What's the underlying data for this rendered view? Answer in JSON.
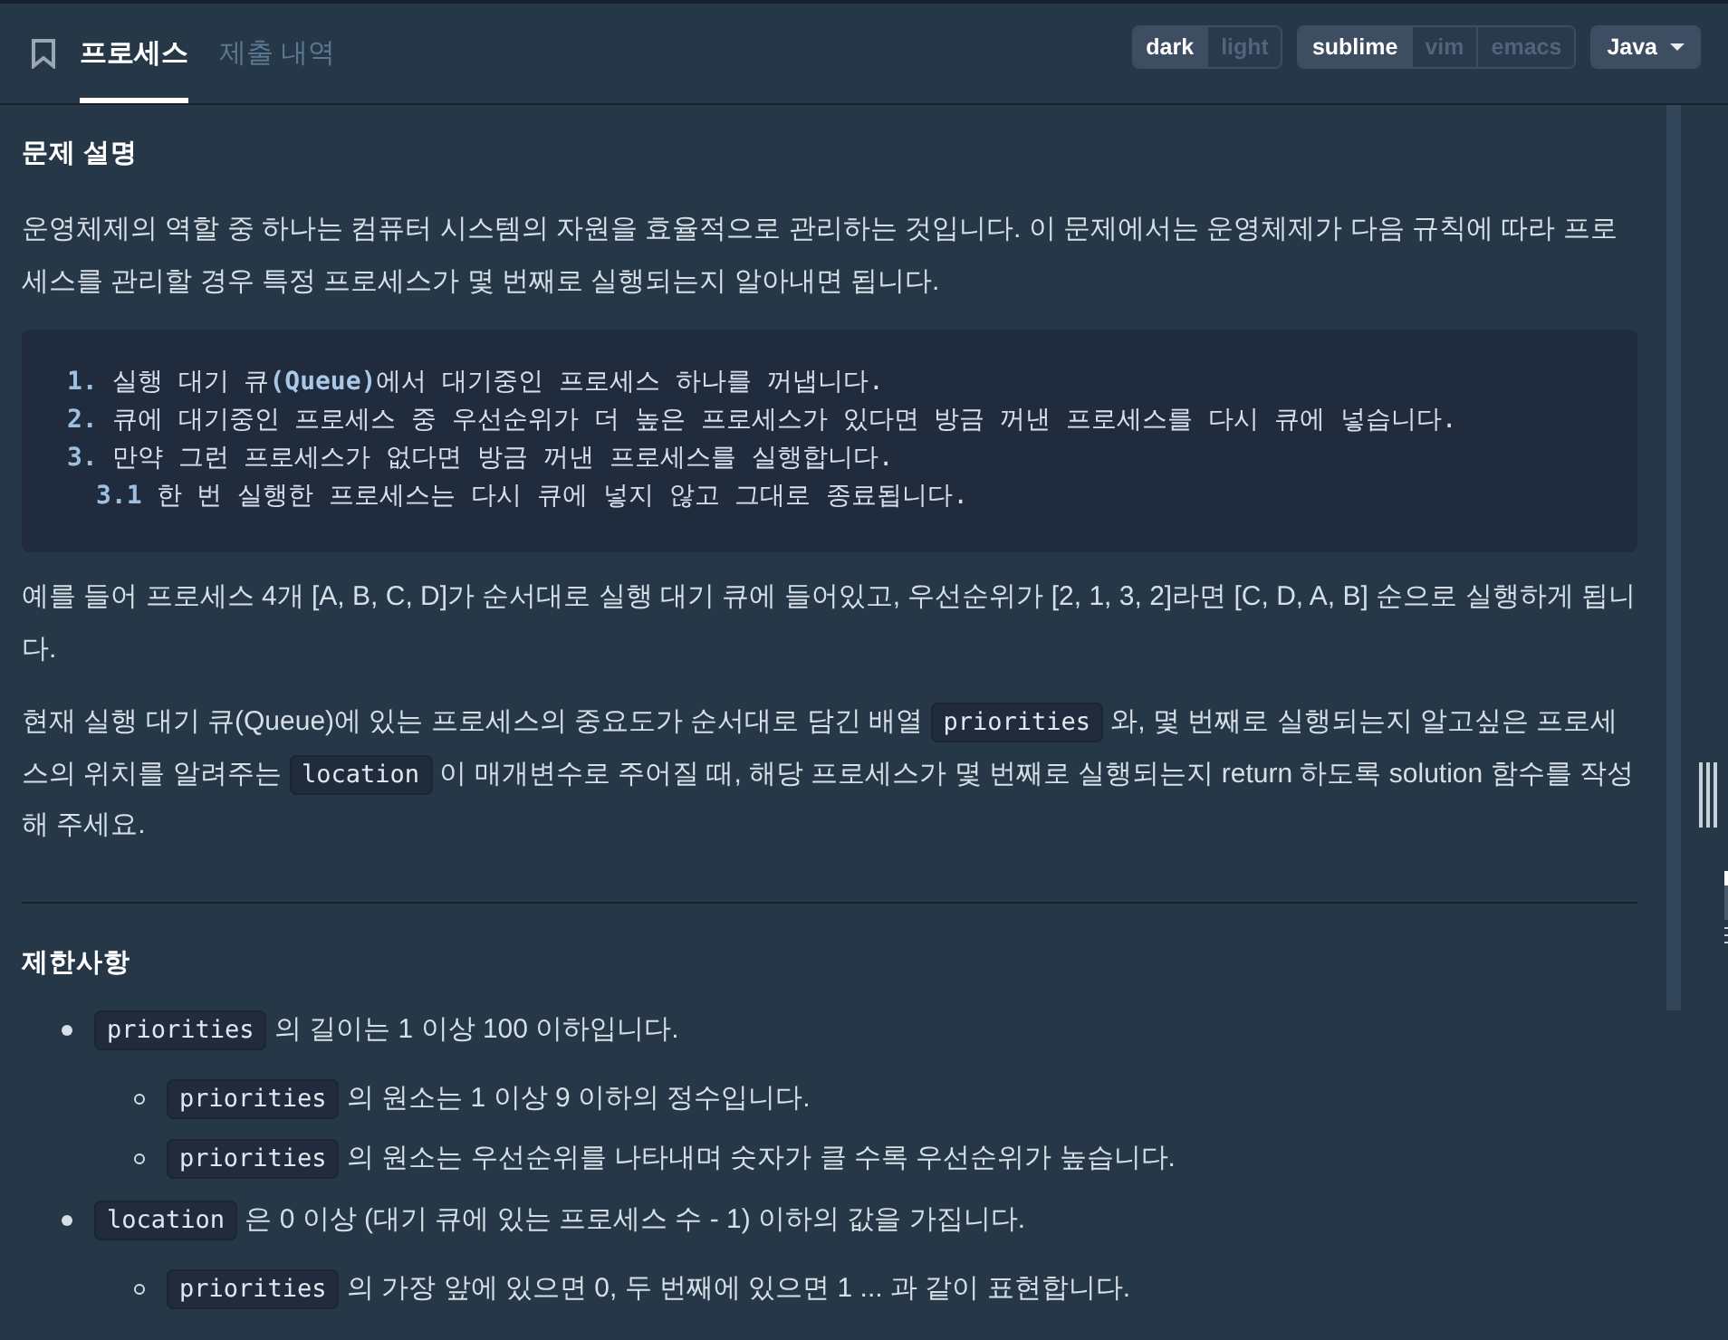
{
  "header": {
    "tabs": [
      {
        "label": "프로세스",
        "selected": true
      },
      {
        "label": "제출 내역",
        "selected": false
      }
    ],
    "theme_toggle": [
      {
        "label": "dark",
        "selected": true
      },
      {
        "label": "light",
        "selected": false
      }
    ],
    "keymap_toggle": [
      {
        "label": "sublime",
        "selected": true
      },
      {
        "label": "vim",
        "selected": false
      },
      {
        "label": "emacs",
        "selected": false
      }
    ],
    "language_dropdown": {
      "value": "Java"
    }
  },
  "sections": [
    {
      "title": "문제 설명",
      "blocks": [
        {
          "kind": "paragraph",
          "segments": [
            {
              "kind": "text",
              "text": "운영체제의 역할 중 하나는 컴퓨터 시스템의 자원을 효율적으로 관리하는 것입니다. 이 문제에서는 운영체제가 다음 규칙에 따라 프로세스를 관리할 경우 특정 프로세스가 몇 번째로 실행되는지 알아내면 됩니다."
            }
          ]
        },
        {
          "kind": "code_block",
          "lines": [
            {
              "marker": "1.",
              "text": "실행 대기 큐**(Queue)**에서 대기중인 프로세스 하나를 꺼냅니다."
            },
            {
              "marker": "2.",
              "text": "큐에 대기중인 프로세스 중 우선순위가 더 높은 프로세스가 있다면 방금 꺼낸 프로세스를 다시 큐에 넣습니다."
            },
            {
              "marker": "3.",
              "text": "만약 그런 프로세스가 없다면 방금 꺼낸 프로세스를 실행합니다.",
              "children": [
                {
                  "marker": "3.1",
                  "text": "한 번 실행한 프로세스는 다시 큐에 넣지 않고 그대로 종료됩니다."
                }
              ]
            }
          ]
        },
        {
          "kind": "paragraph",
          "segments": [
            {
              "kind": "text",
              "text": "예를 들어 프로세스 4개 [A, B, C, D]가 순서대로 실행 대기 큐에 들어있고, 우선순위가 [2, 1, 3, 2]라면 [C, D, A, B] 순으로 실행하게 됩니다."
            }
          ]
        },
        {
          "kind": "paragraph",
          "segments": [
            {
              "kind": "text",
              "text": "현재 실행 대기 큐(Queue)에 있는 프로세스의 중요도가 순서대로 담긴 배열 "
            },
            {
              "kind": "code",
              "text": "priorities"
            },
            {
              "kind": "text",
              "text": " 와, 몇 번째로 실행되는지 알고싶은 프로세스의 위치를 알려주는 "
            },
            {
              "kind": "code",
              "text": "location"
            },
            {
              "kind": "text",
              "text": " 이 매개변수로 주어질 때, 해당 프로세스가 몇 번째로 실행되는지 return 하도록 solution 함수를 작성해 주세요."
            }
          ]
        }
      ]
    },
    {
      "title": "제한사항",
      "blocks": [
        {
          "kind": "list",
          "items": [
            {
              "segments": [
                {
                  "kind": "code",
                  "text": "priorities"
                },
                {
                  "kind": "text",
                  "text": " 의 길이는 1 이상 100 이하입니다."
                }
              ],
              "children": [
                {
                  "segments": [
                    {
                      "kind": "code",
                      "text": "priorities"
                    },
                    {
                      "kind": "text",
                      "text": " 의 원소는 1 이상 9 이하의 정수입니다."
                    }
                  ]
                },
                {
                  "segments": [
                    {
                      "kind": "code",
                      "text": "priorities"
                    },
                    {
                      "kind": "text",
                      "text": " 의 원소는 우선순위를 나타내며 숫자가 클 수록 우선순위가 높습니다."
                    }
                  ]
                }
              ]
            },
            {
              "segments": [
                {
                  "kind": "code",
                  "text": "location"
                },
                {
                  "kind": "text",
                  "text": " 은 0 이상 (대기 큐에 있는 프로세스 수 - 1) 이하의 값을 가집니다."
                }
              ],
              "children": [
                {
                  "segments": [
                    {
                      "kind": "code",
                      "text": "priorities"
                    },
                    {
                      "kind": "text",
                      "text": " 의 가장 앞에 있으면 0, 두 번째에 있으면 1 ... 과 같이 표현합니다."
                    }
                  ]
                }
              ]
            }
          ]
        }
      ]
    }
  ]
}
